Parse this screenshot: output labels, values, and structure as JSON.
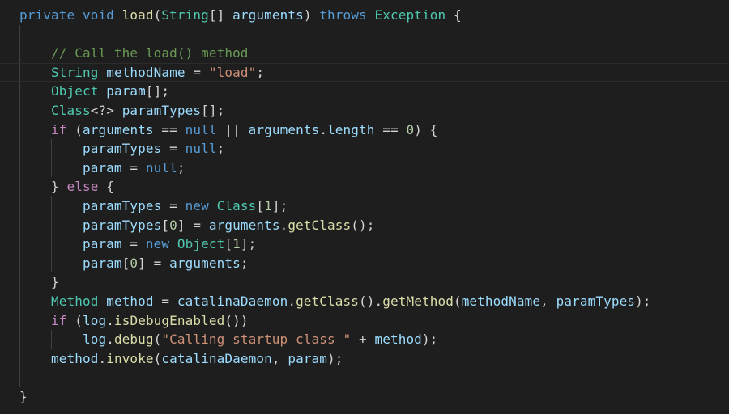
{
  "editor": {
    "lines": [
      {
        "tokens": [
          {
            "t": "private",
            "c": "kw"
          },
          {
            "t": " "
          },
          {
            "t": "void",
            "c": "kw"
          },
          {
            "t": " "
          },
          {
            "t": "load",
            "c": "fn"
          },
          {
            "t": "("
          },
          {
            "t": "String",
            "c": "ty"
          },
          {
            "t": "[] "
          },
          {
            "t": "arguments",
            "c": "vr"
          },
          {
            "t": ") "
          },
          {
            "t": "throws",
            "c": "kw"
          },
          {
            "t": " "
          },
          {
            "t": "Exception",
            "c": "ty"
          },
          {
            "t": " {"
          }
        ]
      },
      {
        "tokens": []
      },
      {
        "tokens": [
          {
            "t": "    "
          },
          {
            "t": "// Call the load() method",
            "c": "cm"
          }
        ]
      },
      {
        "tokens": [
          {
            "t": "    "
          },
          {
            "t": "String",
            "c": "ty"
          },
          {
            "t": " "
          },
          {
            "t": "methodName",
            "c": "vr"
          },
          {
            "t": " = "
          },
          {
            "t": "\"load\"",
            "c": "st"
          },
          {
            "t": ";"
          }
        ],
        "current": true
      },
      {
        "tokens": [
          {
            "t": "    "
          },
          {
            "t": "Object",
            "c": "ty"
          },
          {
            "t": " "
          },
          {
            "t": "param",
            "c": "vr"
          },
          {
            "t": "[];"
          }
        ]
      },
      {
        "tokens": [
          {
            "t": "    "
          },
          {
            "t": "Class",
            "c": "ty"
          },
          {
            "t": "<?> "
          },
          {
            "t": "paramTypes",
            "c": "vr"
          },
          {
            "t": "[];"
          }
        ]
      },
      {
        "tokens": [
          {
            "t": "    "
          },
          {
            "t": "if",
            "c": "kwc"
          },
          {
            "t": " ("
          },
          {
            "t": "arguments",
            "c": "vr"
          },
          {
            "t": " == "
          },
          {
            "t": "null",
            "c": "kw"
          },
          {
            "t": " || "
          },
          {
            "t": "arguments",
            "c": "vr"
          },
          {
            "t": "."
          },
          {
            "t": "length",
            "c": "vr"
          },
          {
            "t": " == "
          },
          {
            "t": "0",
            "c": "nm"
          },
          {
            "t": ") {"
          }
        ]
      },
      {
        "tokens": [
          {
            "t": "        "
          },
          {
            "t": "paramTypes",
            "c": "vr"
          },
          {
            "t": " = "
          },
          {
            "t": "null",
            "c": "kw"
          },
          {
            "t": ";"
          }
        ]
      },
      {
        "tokens": [
          {
            "t": "        "
          },
          {
            "t": "param",
            "c": "vr"
          },
          {
            "t": " = "
          },
          {
            "t": "null",
            "c": "kw"
          },
          {
            "t": ";"
          }
        ]
      },
      {
        "tokens": [
          {
            "t": "    } "
          },
          {
            "t": "else",
            "c": "kwc"
          },
          {
            "t": " {"
          }
        ]
      },
      {
        "tokens": [
          {
            "t": "        "
          },
          {
            "t": "paramTypes",
            "c": "vr"
          },
          {
            "t": " = "
          },
          {
            "t": "new",
            "c": "kw"
          },
          {
            "t": " "
          },
          {
            "t": "Class",
            "c": "ty"
          },
          {
            "t": "["
          },
          {
            "t": "1",
            "c": "nm"
          },
          {
            "t": "];"
          }
        ]
      },
      {
        "tokens": [
          {
            "t": "        "
          },
          {
            "t": "paramTypes",
            "c": "vr"
          },
          {
            "t": "["
          },
          {
            "t": "0",
            "c": "nm"
          },
          {
            "t": "] = "
          },
          {
            "t": "arguments",
            "c": "vr"
          },
          {
            "t": "."
          },
          {
            "t": "getClass",
            "c": "fn"
          },
          {
            "t": "();"
          }
        ]
      },
      {
        "tokens": [
          {
            "t": "        "
          },
          {
            "t": "param",
            "c": "vr"
          },
          {
            "t": " = "
          },
          {
            "t": "new",
            "c": "kw"
          },
          {
            "t": " "
          },
          {
            "t": "Object",
            "c": "ty"
          },
          {
            "t": "["
          },
          {
            "t": "1",
            "c": "nm"
          },
          {
            "t": "];"
          }
        ]
      },
      {
        "tokens": [
          {
            "t": "        "
          },
          {
            "t": "param",
            "c": "vr"
          },
          {
            "t": "["
          },
          {
            "t": "0",
            "c": "nm"
          },
          {
            "t": "] = "
          },
          {
            "t": "arguments",
            "c": "vr"
          },
          {
            "t": ";"
          }
        ]
      },
      {
        "tokens": [
          {
            "t": "    }"
          }
        ]
      },
      {
        "tokens": [
          {
            "t": "    "
          },
          {
            "t": "Method",
            "c": "ty"
          },
          {
            "t": " "
          },
          {
            "t": "method",
            "c": "vr"
          },
          {
            "t": " = "
          },
          {
            "t": "catalinaDaemon",
            "c": "vr"
          },
          {
            "t": "."
          },
          {
            "t": "getClass",
            "c": "fn"
          },
          {
            "t": "()."
          },
          {
            "t": "getMethod",
            "c": "fn"
          },
          {
            "t": "("
          },
          {
            "t": "methodName",
            "c": "vr"
          },
          {
            "t": ", "
          },
          {
            "t": "paramTypes",
            "c": "vr"
          },
          {
            "t": ");"
          }
        ]
      },
      {
        "tokens": [
          {
            "t": "    "
          },
          {
            "t": "if",
            "c": "kwc"
          },
          {
            "t": " ("
          },
          {
            "t": "log",
            "c": "vr"
          },
          {
            "t": "."
          },
          {
            "t": "isDebugEnabled",
            "c": "fn"
          },
          {
            "t": "())"
          }
        ]
      },
      {
        "tokens": [
          {
            "t": "        "
          },
          {
            "t": "log",
            "c": "vr"
          },
          {
            "t": "."
          },
          {
            "t": "debug",
            "c": "fn"
          },
          {
            "t": "("
          },
          {
            "t": "\"Calling startup class \"",
            "c": "st"
          },
          {
            "t": " + "
          },
          {
            "t": "method",
            "c": "vr"
          },
          {
            "t": ");"
          }
        ]
      },
      {
        "tokens": [
          {
            "t": "    "
          },
          {
            "t": "method",
            "c": "vr"
          },
          {
            "t": "."
          },
          {
            "t": "invoke",
            "c": "fn"
          },
          {
            "t": "("
          },
          {
            "t": "catalinaDaemon",
            "c": "vr"
          },
          {
            "t": ", "
          },
          {
            "t": "param",
            "c": "vr"
          },
          {
            "t": ");"
          }
        ]
      },
      {
        "tokens": []
      },
      {
        "tokens": [
          {
            "t": "}"
          }
        ]
      }
    ]
  },
  "colors": {
    "background": "#1e1e1e",
    "keyword": "#569cd6",
    "control_keyword": "#c586c0",
    "type": "#4ec9b0",
    "function": "#dcdcaa",
    "variable": "#9cdcfe",
    "string": "#ce9178",
    "number": "#b5cea8",
    "comment": "#6a9955",
    "plain": "#d4d4d4"
  }
}
